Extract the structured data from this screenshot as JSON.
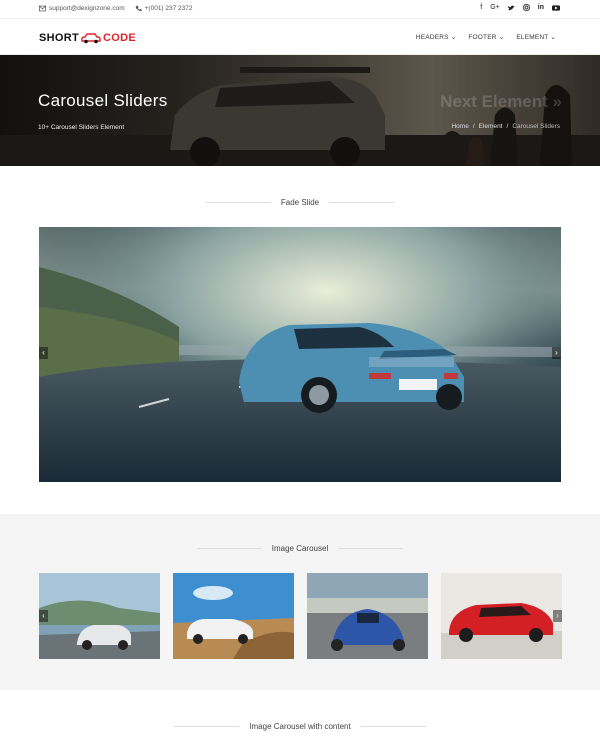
{
  "topbar": {
    "email": "support@dexignzone.com",
    "phone": "+(001) 237 2372",
    "social": [
      "facebook-icon",
      "google-plus-icon",
      "twitter-icon",
      "instagram-icon",
      "linkedin-icon",
      "youtube-icon"
    ]
  },
  "nav": {
    "logo_short": "SHORT",
    "logo_code": "CODE",
    "menu": [
      "HEADERS",
      "FOOTER",
      "ELEMENT"
    ]
  },
  "hero": {
    "title": "Carousel Sliders",
    "subtitle": "10+ Carousel Sliders Element",
    "next": "Next Element »",
    "breadcrumbs": [
      "Home",
      "Element",
      "Carousel Sliders"
    ]
  },
  "sections": {
    "fade_slide": "Fade Slide",
    "image_carousel": "Image Carousel",
    "image_carousel_content": "Image Carousel with content"
  },
  "colors": {
    "accent": "#e0242b",
    "band": "#f5f5f5"
  }
}
